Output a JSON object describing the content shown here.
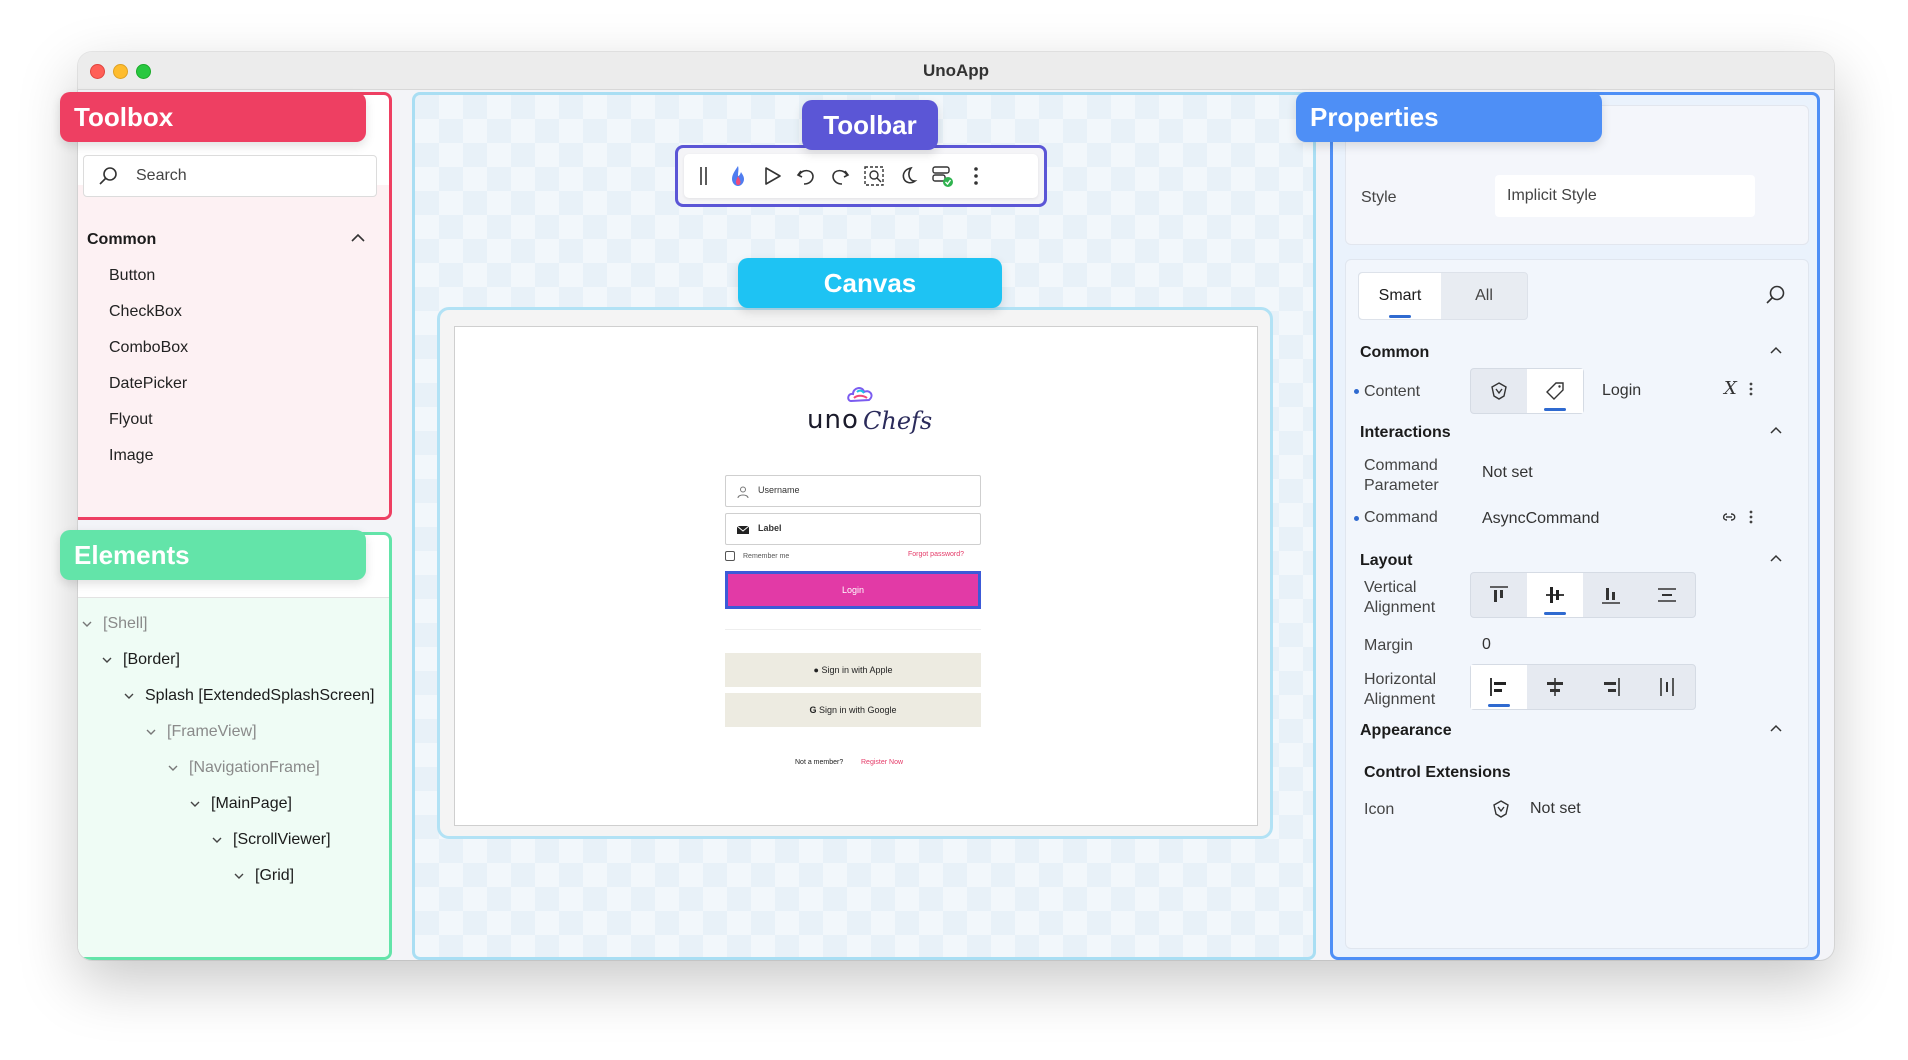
{
  "window": {
    "title": "UnoApp"
  },
  "labels": {
    "toolbox": "Toolbox",
    "elements": "Elements",
    "toolbar": "Toolbar",
    "canvas": "Canvas",
    "properties": "Properties"
  },
  "toolbox": {
    "search_placeholder": "Search",
    "section": "Common",
    "items": [
      "Button",
      "CheckBox",
      "ComboBox",
      "DatePicker",
      "Flyout",
      "Image"
    ]
  },
  "elements": {
    "tree": [
      {
        "label": "[Shell]",
        "muted": true
      },
      {
        "label": "[Border]",
        "muted": false
      },
      {
        "label": "Splash [ExtendedSplashScreen]",
        "muted": false
      },
      {
        "label": "[FrameView]",
        "muted": true
      },
      {
        "label": "[NavigationFrame]",
        "muted": true
      },
      {
        "label": "[MainPage]",
        "muted": false
      },
      {
        "label": "[ScrollViewer]",
        "muted": false
      },
      {
        "label": "[Grid]",
        "muted": false
      }
    ]
  },
  "toolbar": {
    "icons": [
      "drag-handle-icon",
      "hot-reload-flame-icon",
      "play-icon",
      "undo-icon",
      "redo-icon",
      "select-element-icon",
      "theme-toggle-icon",
      "layout-check-icon",
      "more-icon"
    ]
  },
  "canvas": {
    "app": {
      "logo_text": "uno",
      "logo_script": "Chefs",
      "username_placeholder": "Username",
      "password_placeholder": "Label",
      "remember_me": "Remember me",
      "forgot_password": "Forgot password?",
      "login": "Login",
      "sign_in_apple": "Sign in with Apple",
      "sign_in_google": "Sign in with Google",
      "not_member": "Not a member?",
      "register": "Register Now"
    }
  },
  "properties": {
    "style_label": "Style",
    "style_value": "Implicit Style",
    "tabs": [
      "Smart",
      "All"
    ],
    "sections": {
      "common": "Common",
      "interactions": "Interactions",
      "layout": "Layout",
      "appearance": "Appearance",
      "control_extensions": "Control Extensions"
    },
    "content": {
      "label": "Content",
      "value": "Login"
    },
    "command_parameter": {
      "label": "Command\nParameter",
      "value": "Not set"
    },
    "command": {
      "label": "Command",
      "value": "AsyncCommand"
    },
    "vertical_alignment": {
      "label": "Vertical\nAlignment"
    },
    "margin": {
      "label": "Margin",
      "value": "0"
    },
    "horizontal_alignment": {
      "label": "Horizontal\nAlignment"
    },
    "icon": {
      "label": "Icon",
      "value": "Not set"
    }
  },
  "colors": {
    "toolbox": "#ee3f62",
    "elements": "#63e4a9",
    "toolbar": "#5b56d6",
    "canvas": "#1ec3f3",
    "properties": "#4e8ff6",
    "login_button": "#e23aa6"
  }
}
